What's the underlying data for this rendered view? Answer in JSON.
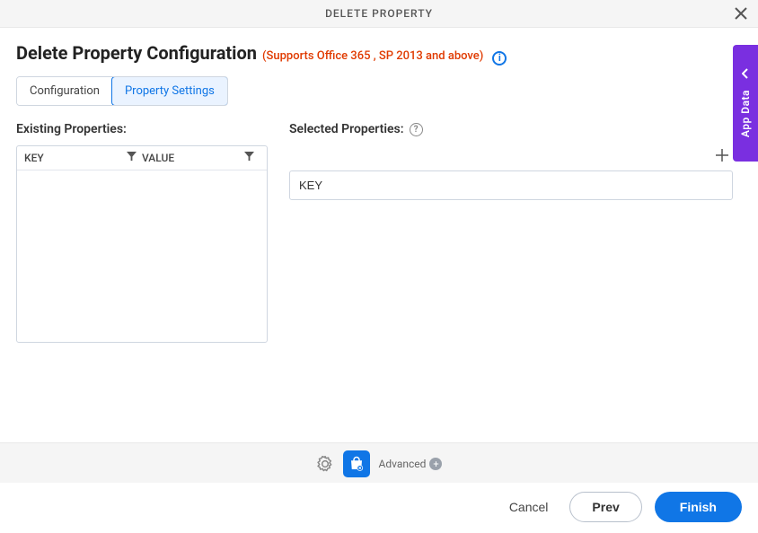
{
  "header": {
    "title": "DELETE PROPERTY"
  },
  "page": {
    "title": "Delete Property Configuration",
    "support_note": "(Supports Office 365 , SP 2013 and above)"
  },
  "tabs": [
    {
      "label": "Configuration",
      "active": false
    },
    {
      "label": "Property Settings",
      "active": true
    }
  ],
  "existing": {
    "label": "Existing Properties:",
    "columns": [
      "KEY",
      "VALUE"
    ]
  },
  "selected": {
    "label": "Selected Properties:",
    "value": "KEY"
  },
  "side_tab": {
    "label": "App Data"
  },
  "footer": {
    "advanced_label": "Advanced",
    "cancel": "Cancel",
    "prev": "Prev",
    "finish": "Finish"
  }
}
